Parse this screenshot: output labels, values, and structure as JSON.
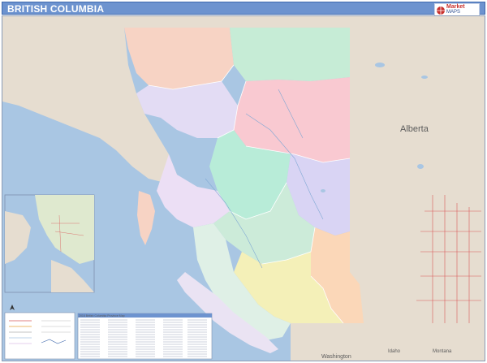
{
  "title": "BRITISH COLUMBIA",
  "logo": {
    "brand": "Market",
    "sub": "MAPS"
  },
  "labels": {
    "alberta": "Alberta",
    "washington": "Washington",
    "idaho": "Idaho",
    "montana": "Montana"
  },
  "legend": {
    "title": "2016 British Columbia Province Map"
  },
  "colors": {
    "water": "#a9c6e3",
    "land_outside": "#e6ddd0",
    "title_bar": "#6d93cf",
    "roads": "#d95a5a"
  }
}
